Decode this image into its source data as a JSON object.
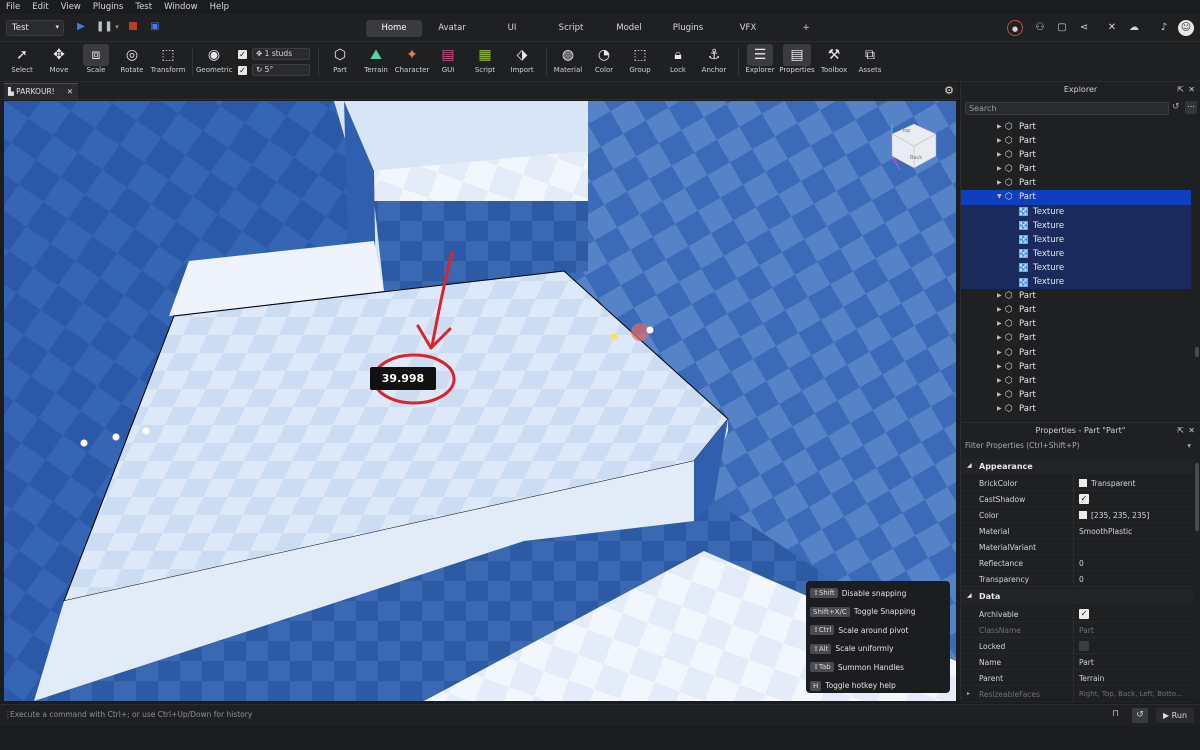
{
  "menu": [
    "File",
    "Edit",
    "View",
    "Plugins",
    "Test",
    "Window",
    "Help"
  ],
  "header": {
    "mode": "Test",
    "tabs": [
      "Home",
      "Avatar",
      "UI",
      "Script",
      "Model",
      "Plugins",
      "VFX"
    ],
    "active_tab": "Home",
    "add_tab": "+"
  },
  "ribbon": {
    "tools": {
      "select": "Select",
      "move": "Move",
      "scale": "Scale",
      "rotate": "Rotate",
      "transform": "Transform",
      "geometric": "Geometric",
      "part": "Part",
      "terrain": "Terrain",
      "character": "Character",
      "gui": "GUI",
      "script": "Script",
      "import": "Import",
      "material": "Material",
      "color": "Color",
      "group": "Group",
      "lock": "Lock",
      "anchor": "Anchor",
      "explorer": "Explorer",
      "properties": "Properties",
      "toolbox": "Toolbox",
      "assets": "Assets"
    },
    "move_snap": "1 studs",
    "rotate_snap": "5°"
  },
  "document_tab": "PARKOUR!",
  "viewport": {
    "measurement": "39.998",
    "cube_labels": [
      "Top",
      "Back"
    ]
  },
  "hotkeys": [
    {
      "key": "⇧Shift",
      "label": "Disable snapping"
    },
    {
      "key": "Shift+X/C",
      "label": "Toggle Snapping"
    },
    {
      "key": "⇧Ctrl",
      "label": "Scale around pivot"
    },
    {
      "key": "⇧Alt",
      "label": "Scale uniformly"
    },
    {
      "key": "⇧Tab",
      "label": "Summon Handles"
    },
    {
      "key": "H",
      "label": "Toggle hotkey help"
    }
  ],
  "explorer": {
    "title": "Explorer",
    "search_placeholder": "Search",
    "rows": [
      {
        "name": "Part",
        "level": 0,
        "type": "part"
      },
      {
        "name": "Part",
        "level": 0,
        "type": "part"
      },
      {
        "name": "Part",
        "level": 0,
        "type": "part"
      },
      {
        "name": "Part",
        "level": 0,
        "type": "part"
      },
      {
        "name": "Part",
        "level": 0,
        "type": "part"
      },
      {
        "name": "Part",
        "level": 0,
        "type": "part",
        "selected": true,
        "expanded": true
      },
      {
        "name": "Texture",
        "level": 1,
        "type": "texture"
      },
      {
        "name": "Texture",
        "level": 1,
        "type": "texture"
      },
      {
        "name": "Texture",
        "level": 1,
        "type": "texture"
      },
      {
        "name": "Texture",
        "level": 1,
        "type": "texture"
      },
      {
        "name": "Texture",
        "level": 1,
        "type": "texture"
      },
      {
        "name": "Texture",
        "level": 1,
        "type": "texture"
      },
      {
        "name": "Part",
        "level": 0,
        "type": "part"
      },
      {
        "name": "Part",
        "level": 0,
        "type": "part"
      },
      {
        "name": "Part",
        "level": 0,
        "type": "part"
      },
      {
        "name": "Part",
        "level": 0,
        "type": "part"
      },
      {
        "name": "Part",
        "level": 0,
        "type": "part"
      },
      {
        "name": "Part",
        "level": 0,
        "type": "part"
      },
      {
        "name": "Part",
        "level": 0,
        "type": "part"
      },
      {
        "name": "Part",
        "level": 0,
        "type": "part"
      },
      {
        "name": "Part",
        "level": 0,
        "type": "part"
      }
    ]
  },
  "properties": {
    "title": "Properties - Part \"Part\"",
    "filter_placeholder": "Filter Properties (Ctrl+Shift+P)",
    "appearance": {
      "section": "Appearance",
      "brick_color_label": "BrickColor",
      "brick_color_value": "Transparent",
      "cast_shadow_label": "CastShadow",
      "color_label": "Color",
      "color_value": "[235, 235, 235]",
      "material_label": "Material",
      "material_value": "SmoothPlastic",
      "material_variant_label": "MaterialVariant",
      "reflectance_label": "Reflectance",
      "reflectance_value": "0",
      "transparency_label": "Transparency",
      "transparency_value": "0"
    },
    "data": {
      "section": "Data",
      "archivable_label": "Archivable",
      "classname_label": "ClassName",
      "classname_value": "Part",
      "locked_label": "Locked",
      "name_label": "Name",
      "name_value": "Part",
      "parent_label": "Parent",
      "parent_value": "Terrain",
      "resizeable_label": "ResizeableFaces",
      "resizeable_value": "Right, Top, Back, Left, Botto..."
    }
  },
  "command": {
    "placeholder": "Execute a command with Ctrl+; or use Ctrl+Up/Down for history",
    "run_label": "Run"
  },
  "colors": {
    "accent": "#0f3fbf",
    "viewport_blue": "#2a55a0",
    "floor": "#e6eefb"
  }
}
